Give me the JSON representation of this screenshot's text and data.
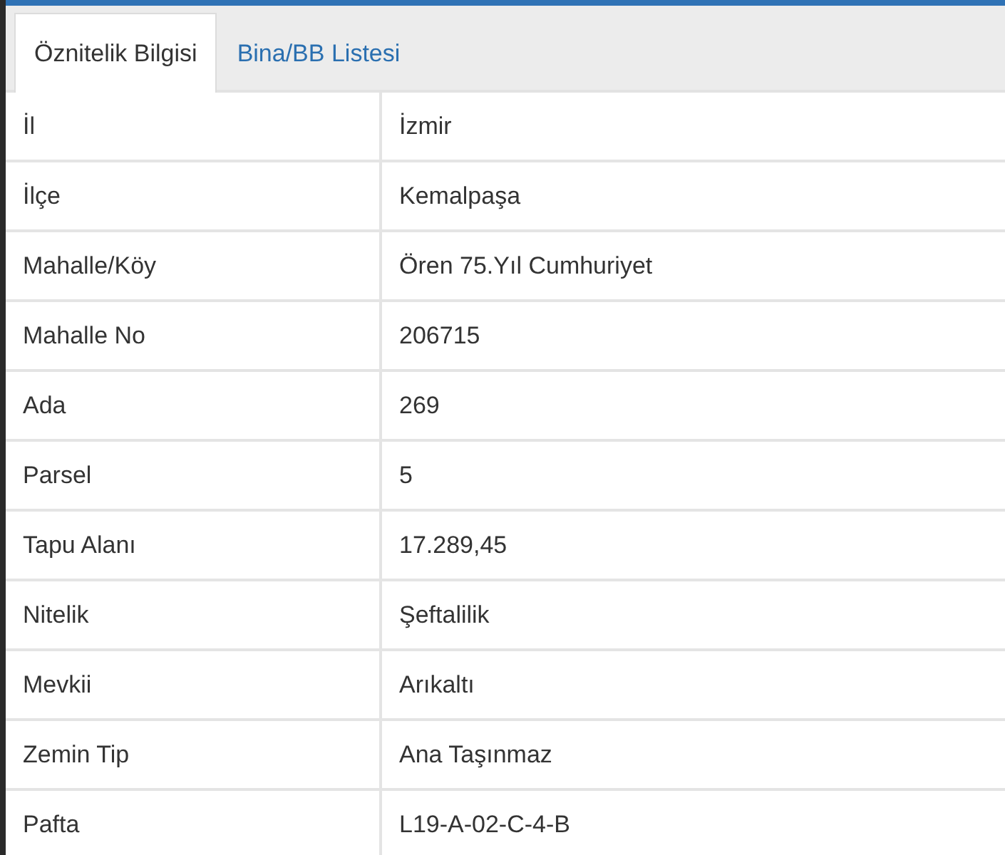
{
  "tabs": [
    {
      "label": "Öznitelik Bilgisi",
      "selected": true
    },
    {
      "label": "Bina/BB Listesi",
      "selected": false
    }
  ],
  "rows": [
    {
      "label": "İl",
      "value": "İzmir"
    },
    {
      "label": "İlçe",
      "value": "Kemalpaşa"
    },
    {
      "label": "Mahalle/Köy",
      "value": "Ören 75.Yıl Cumhuriyet"
    },
    {
      "label": "Mahalle No",
      "value": "206715"
    },
    {
      "label": "Ada",
      "value": "269"
    },
    {
      "label": "Parsel",
      "value": "5"
    },
    {
      "label": "Tapu Alanı",
      "value": "17.289,45"
    },
    {
      "label": "Nitelik",
      "value": "Şeftalilik"
    },
    {
      "label": "Mevkii",
      "value": "Arıkaltı"
    },
    {
      "label": "Zemin Tip",
      "value": "Ana Taşınmaz"
    },
    {
      "label": "Pafta",
      "value": "L19-A-02-C-4-B"
    }
  ]
}
